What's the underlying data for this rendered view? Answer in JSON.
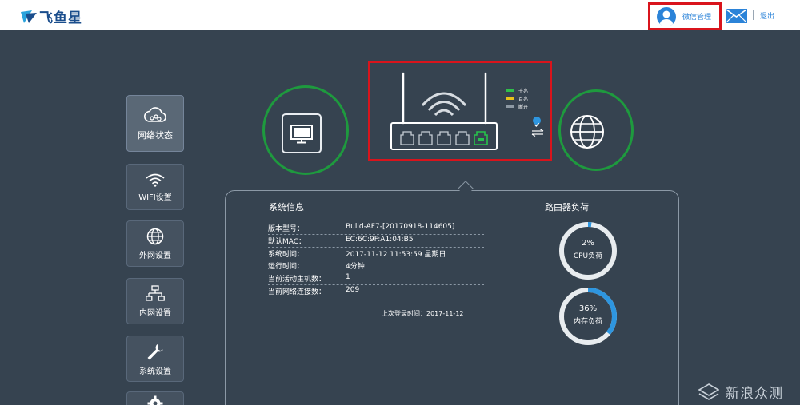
{
  "header": {
    "brand": "飞鱼星",
    "wechat_label": "微信管理",
    "logout_label": "退出"
  },
  "sidebar": {
    "items": [
      {
        "label": "网络状态",
        "icon": "cloud-network-icon",
        "active": true
      },
      {
        "label": "WIFI设置",
        "icon": "wifi-icon",
        "active": false
      },
      {
        "label": "外网设置",
        "icon": "globe-icon",
        "active": false
      },
      {
        "label": "内网设置",
        "icon": "lan-topology-icon",
        "active": false
      },
      {
        "label": "系统设置",
        "icon": "wrench-icon",
        "active": false
      },
      {
        "label": "",
        "icon": "gear-icon",
        "active": false
      }
    ]
  },
  "topology": {
    "legend": [
      {
        "label": "千兆",
        "color": "#2fbf4a"
      },
      {
        "label": "百兆",
        "color": "#e8c21a"
      },
      {
        "label": "断开",
        "color": "#8e99a4"
      }
    ]
  },
  "system_info": {
    "title": "系统信息",
    "rows": [
      {
        "key": "版本型号：",
        "value": "Build-AF7-[20170918-114605]"
      },
      {
        "key": "默认MAC：",
        "value": "EC:6C:9F:A1:04:B5"
      },
      {
        "key": "系统时间：",
        "value": "2017-11-12 11:53:59 星期日"
      },
      {
        "key": "运行时间：",
        "value": "4分钟"
      },
      {
        "key": "当前活动主机数：",
        "value": "1"
      },
      {
        "key": "当前网络连接数：",
        "value": "209"
      }
    ],
    "last_login_label": "上次登录时间：",
    "last_login_value": "2017-11-12"
  },
  "router_load": {
    "title": "路由器负荷",
    "cpu": {
      "percent_label": "2%",
      "name": "CPU负荷",
      "value": 0.02
    },
    "memory": {
      "percent_label": "36%",
      "name": "内存负荷",
      "value": 0.36
    }
  },
  "colors": {
    "accent": "#2b83d8",
    "highlight_red": "#d9141c",
    "circle_green": "#1e9a3e",
    "gauge_track": "#e8ecef",
    "gauge_fill": "#2e96e0"
  },
  "watermark": {
    "text": "新浪众测"
  }
}
